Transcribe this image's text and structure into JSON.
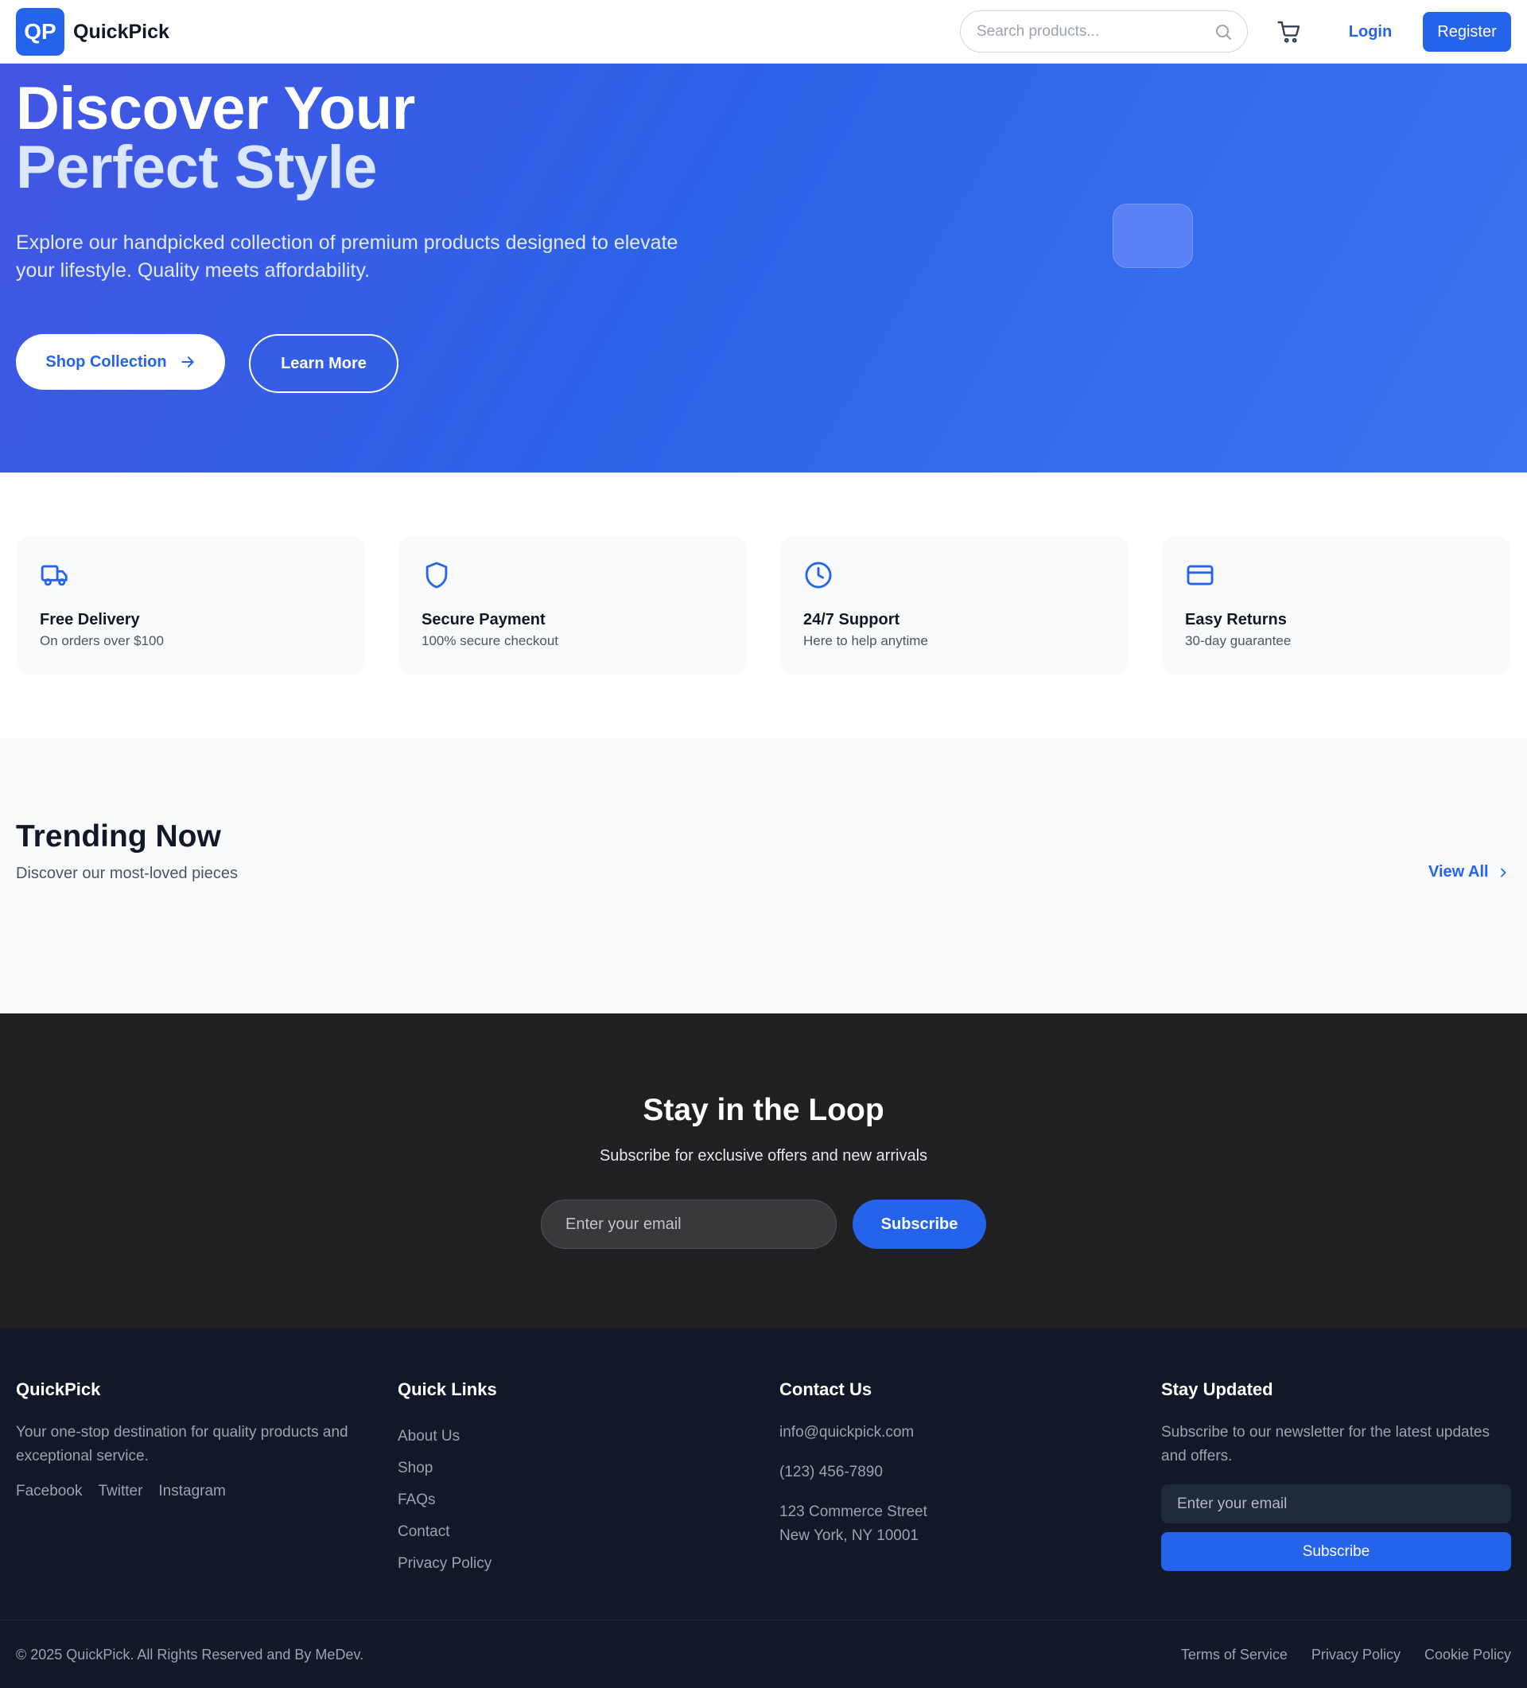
{
  "brand": {
    "badge": "QP",
    "name": "QuickPick"
  },
  "header": {
    "search_placeholder": "Search products...",
    "login_label": "Login",
    "register_label": "Register"
  },
  "hero": {
    "title_line1": "Discover Your",
    "title_line2": "Perfect Style",
    "description": "Explore our handpicked collection of premium products designed to elevate your lifestyle. Quality meets affordability.",
    "shop_label": "Shop Collection",
    "learn_label": "Learn More"
  },
  "features": [
    {
      "title": "Free Delivery",
      "subtitle": "On orders over $100",
      "icon": "truck-icon"
    },
    {
      "title": "Secure Payment",
      "subtitle": "100% secure checkout",
      "icon": "shield-icon"
    },
    {
      "title": "24/7 Support",
      "subtitle": "Here to help anytime",
      "icon": "clock-icon"
    },
    {
      "title": "Easy Returns",
      "subtitle": "30-day guarantee",
      "icon": "credit-card-icon"
    }
  ],
  "trending": {
    "title": "Trending Now",
    "subtitle": "Discover our most-loved pieces",
    "view_all_label": "View All"
  },
  "newsletter": {
    "title": "Stay in the Loop",
    "subtitle": "Subscribe for exclusive offers and new arrivals",
    "email_placeholder": "Enter your email",
    "subscribe_label": "Subscribe"
  },
  "footer": {
    "brand_title": "QuickPick",
    "brand_description": "Your one-stop destination for quality products and exceptional service.",
    "social": [
      "Facebook",
      "Twitter",
      "Instagram"
    ],
    "quick_links_title": "Quick Links",
    "quick_links": [
      "About Us",
      "Shop",
      "FAQs",
      "Contact",
      "Privacy Policy"
    ],
    "contact_title": "Contact Us",
    "contact": {
      "email": "info@quickpick.com",
      "phone": "(123) 456-7890",
      "address_line1": "123 Commerce Street",
      "address_line2": "New York, NY 10001"
    },
    "updates_title": "Stay Updated",
    "updates_description": "Subscribe to our newsletter for the latest updates and offers.",
    "updates_placeholder": "Enter your email",
    "updates_button": "Subscribe",
    "copyright": "© 2025 QuickPick. All Rights Reserved and By MeDev.",
    "legal": [
      "Terms of Service",
      "Privacy Policy",
      "Cookie Policy"
    ]
  },
  "colors": {
    "primary": "#2563eb",
    "hero_gradient_start": "#4355e3",
    "hero_gradient_end": "#3a74f0",
    "newsletter_bg": "#202022",
    "footer_bg": "#111827"
  }
}
